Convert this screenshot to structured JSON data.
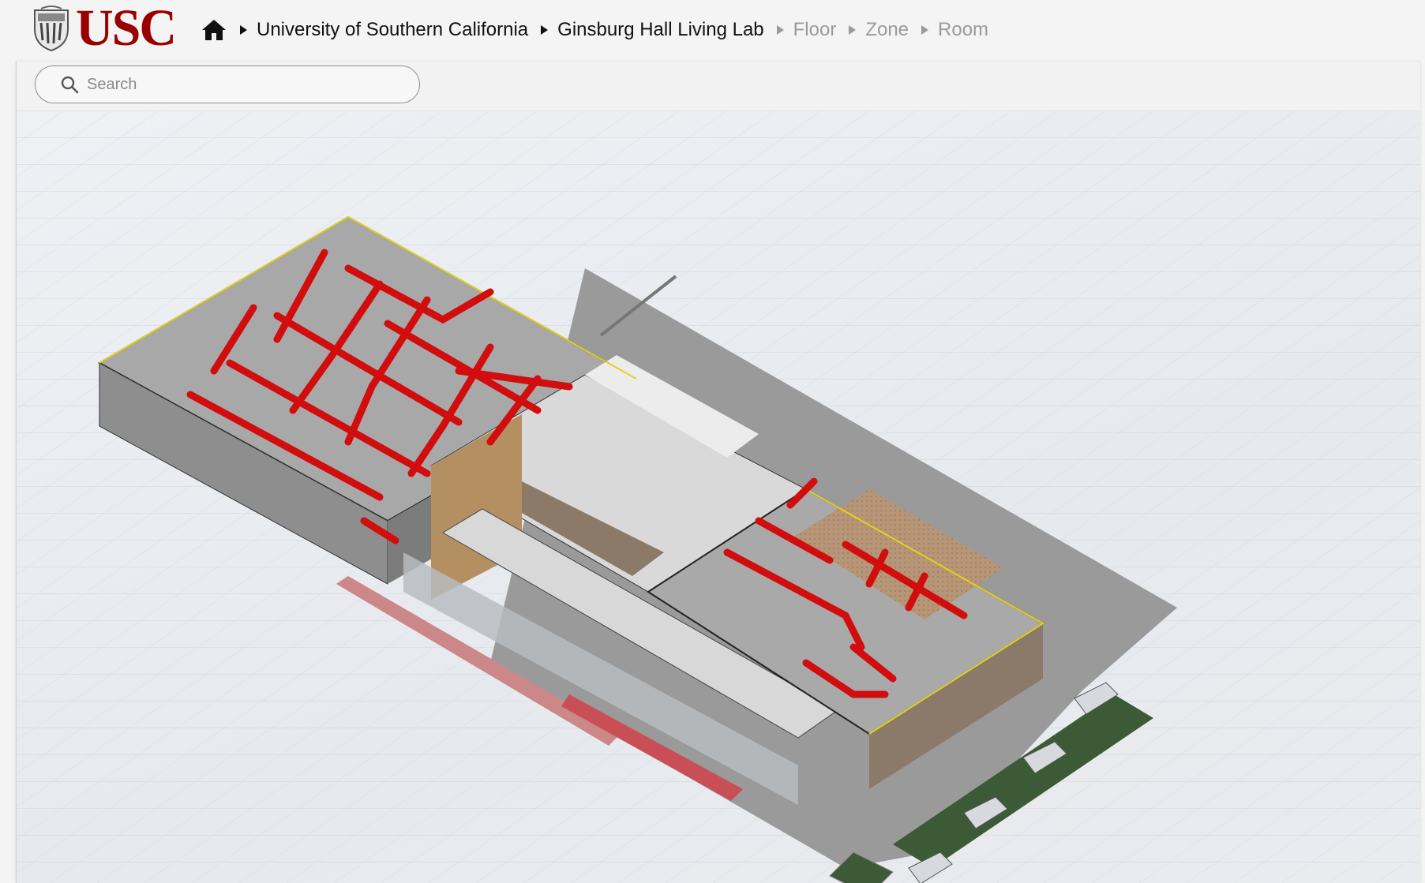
{
  "brand": {
    "wordmark": "USC",
    "color": "#990000"
  },
  "breadcrumb": {
    "items": [
      {
        "label": "University of Southern California",
        "active": true
      },
      {
        "label": "Ginsburg Hall Living Lab",
        "active": true
      },
      {
        "label": "Floor",
        "active": false
      },
      {
        "label": "Zone",
        "active": false
      },
      {
        "label": "Room",
        "active": false
      }
    ]
  },
  "search": {
    "placeholder": "Search",
    "value": ""
  },
  "icons": {
    "home": "home-icon",
    "search": "search-icon",
    "logo": "usc-shield-logo"
  },
  "viewer": {
    "model_colors": {
      "ducts": "#d10d0d",
      "outline": "#e3d21a",
      "lawn": "#3b5a35",
      "wood": "#b89a78"
    }
  }
}
